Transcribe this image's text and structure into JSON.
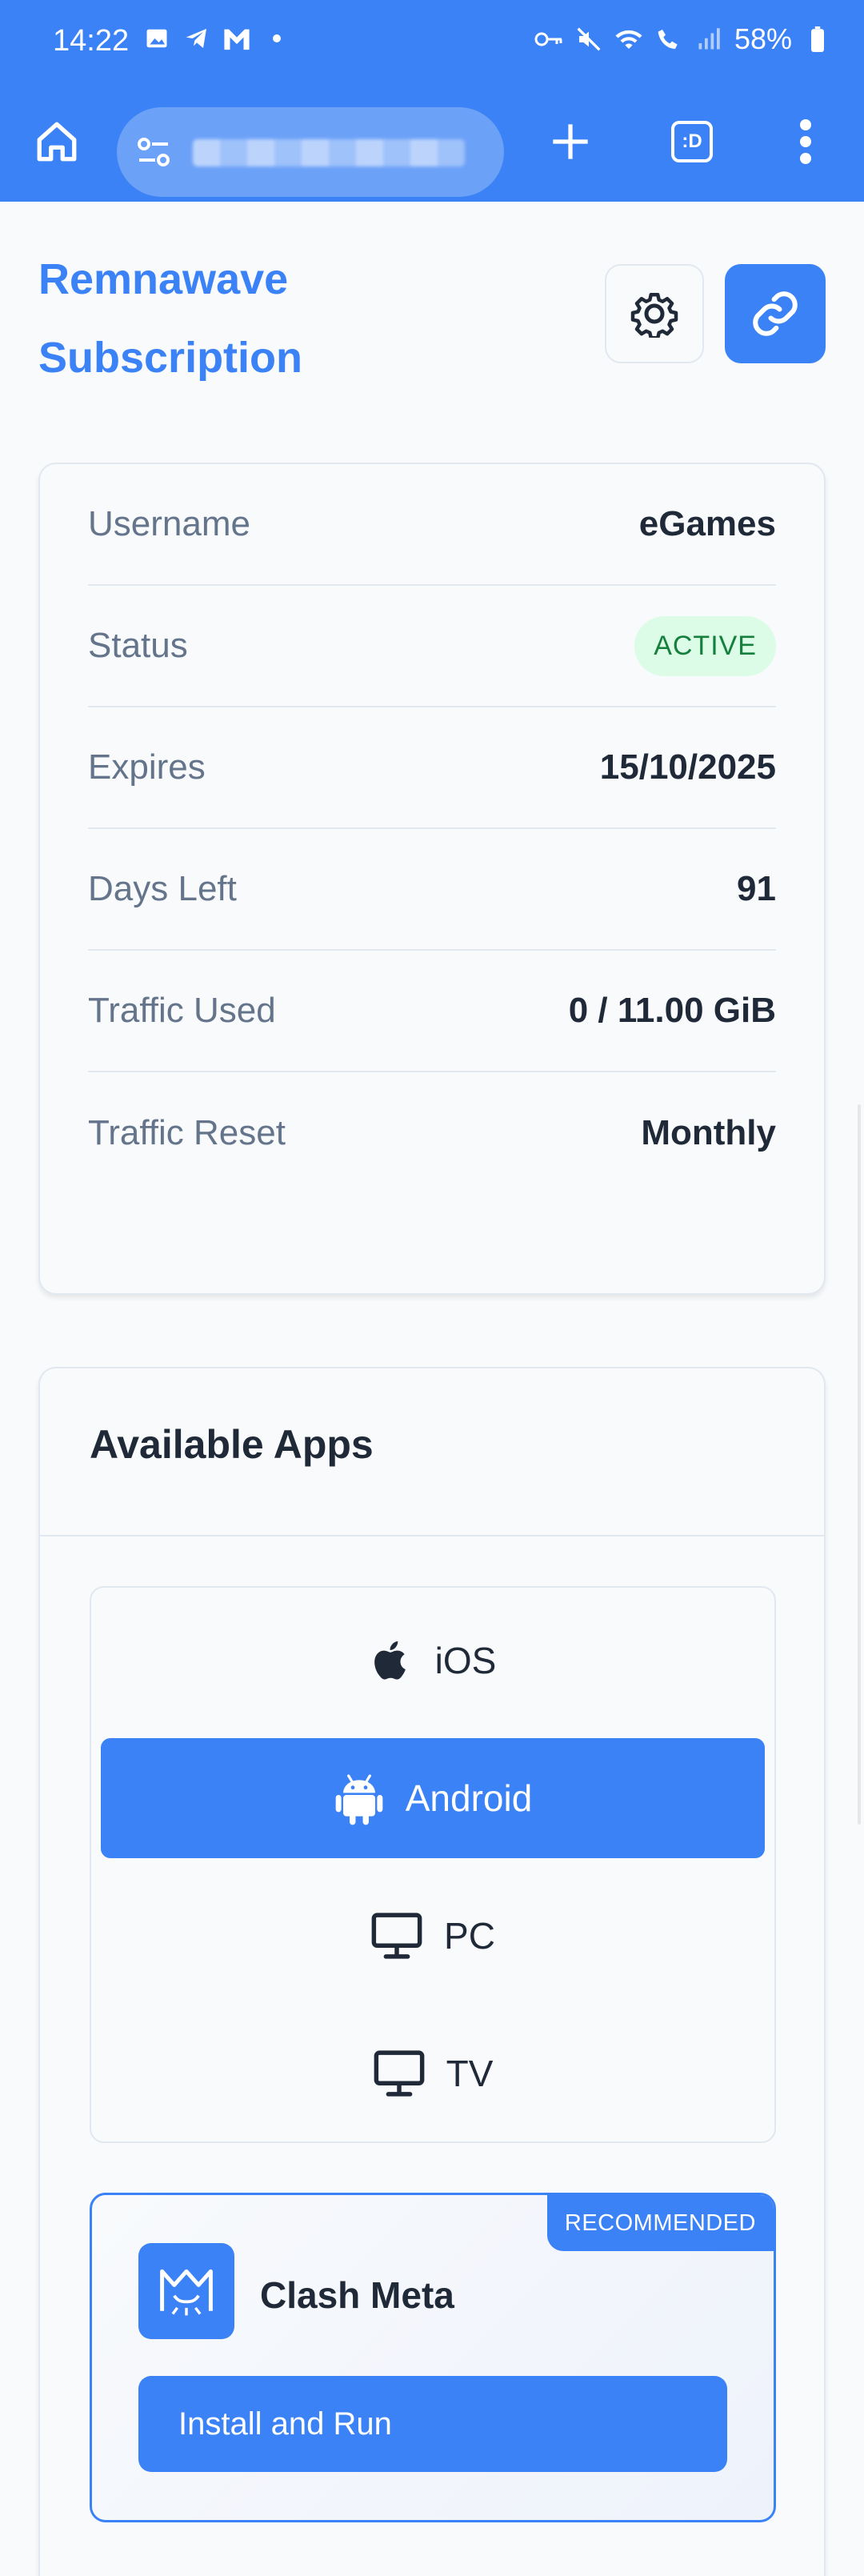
{
  "statusbar": {
    "time": "14:22",
    "battery": "58%",
    "left_icons": [
      "image-icon",
      "telegram-icon",
      "gmail-icon",
      "dot-icon"
    ],
    "right_icons": [
      "key-icon",
      "mute-icon",
      "wifi-icon",
      "wifi-call-icon",
      "signal-icon",
      "battery-icon"
    ]
  },
  "browser": {
    "tabs_label": ":D",
    "url_obscured": true
  },
  "header": {
    "title": "Remnawave Subscription"
  },
  "info": {
    "rows": [
      {
        "label": "Username",
        "value": "eGames"
      },
      {
        "label": "Status",
        "value": "ACTIVE"
      },
      {
        "label": "Expires",
        "value": "15/10/2025"
      },
      {
        "label": "Days Left",
        "value": "91"
      },
      {
        "label": "Traffic Used",
        "value": "0 / 11.00 GiB"
      },
      {
        "label": "Traffic Reset",
        "value": "Monthly"
      }
    ]
  },
  "apps": {
    "title": "Available Apps",
    "platforms": [
      {
        "label": "iOS",
        "icon": "apple-icon",
        "selected": false
      },
      {
        "label": "Android",
        "icon": "android-icon",
        "selected": true
      },
      {
        "label": "PC",
        "icon": "monitor-icon",
        "selected": false
      },
      {
        "label": "TV",
        "icon": "tv-icon",
        "selected": false
      }
    ],
    "items": [
      {
        "name": "Clash Meta",
        "badge": "RECOMMENDED",
        "button": "Install and Run",
        "icon": "clash-meta-icon"
      }
    ]
  },
  "colors": {
    "accent": "#3b82f6",
    "active_badge_bg": "#dcfce7",
    "active_badge_text": "#15803d",
    "muted_text": "#64748b"
  }
}
